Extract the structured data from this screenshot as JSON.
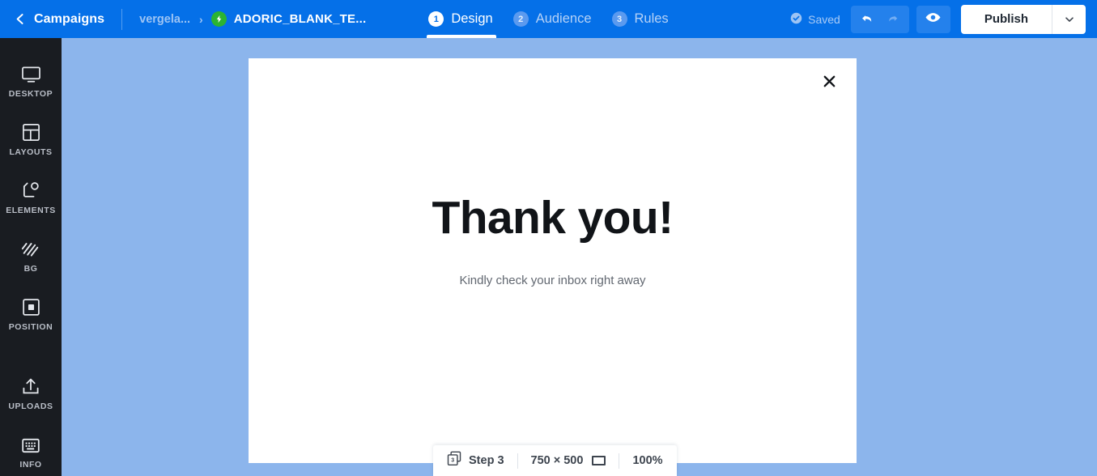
{
  "topbar": {
    "back_icon": "chevron-left-icon",
    "campaigns_label": "Campaigns",
    "breadcrumb_account": "vergela...",
    "breadcrumb_separator": "›",
    "breadcrumb_badge_icon": "bolt-icon",
    "breadcrumb_current": "ADORIC_BLANK_TE...",
    "saved_label": "Saved",
    "saved_icon": "check-circle-icon",
    "undo_icon": "undo-arrow-icon",
    "redo_icon": "redo-arrow-icon",
    "preview_icon": "eye-icon",
    "publish_label": "Publish",
    "publish_caret_icon": "chevron-down-icon",
    "accent_blue": "#0570e8",
    "badge_green": "#2cb431"
  },
  "steps": [
    {
      "number": "1",
      "label": "Design",
      "active": true
    },
    {
      "number": "2",
      "label": "Audience",
      "active": false
    },
    {
      "number": "3",
      "label": "Rules",
      "active": false
    }
  ],
  "sidebar": {
    "background": "#191c21",
    "items": [
      {
        "label": "DESKTOP",
        "icon": "monitor-icon"
      },
      {
        "label": "LAYOUTS",
        "icon": "layouts-grid-icon"
      },
      {
        "label": "ELEMENTS",
        "icon": "elements-shapes-icon"
      },
      {
        "label": "BG",
        "icon": "background-hatch-icon"
      },
      {
        "label": "POSITION",
        "icon": "position-square-icon"
      },
      {
        "label": "UPLOADS",
        "icon": "upload-arrow-icon"
      },
      {
        "label": "INFO",
        "icon": "keyboard-info-icon"
      }
    ]
  },
  "canvas": {
    "background": "#8cb5ec",
    "modal": {
      "close_icon": "close-x-icon",
      "heading": "Thank you!",
      "subtext": "Kindly check your inbox right away",
      "background": "#ffffff"
    }
  },
  "statusbar": {
    "step_icon": "pages-stack-icon",
    "step_badge": "3",
    "step_label": "Step 3",
    "dimensions": "750 × 500",
    "resize_icon": "rectangle-frame-icon",
    "zoom_level": "100%"
  }
}
